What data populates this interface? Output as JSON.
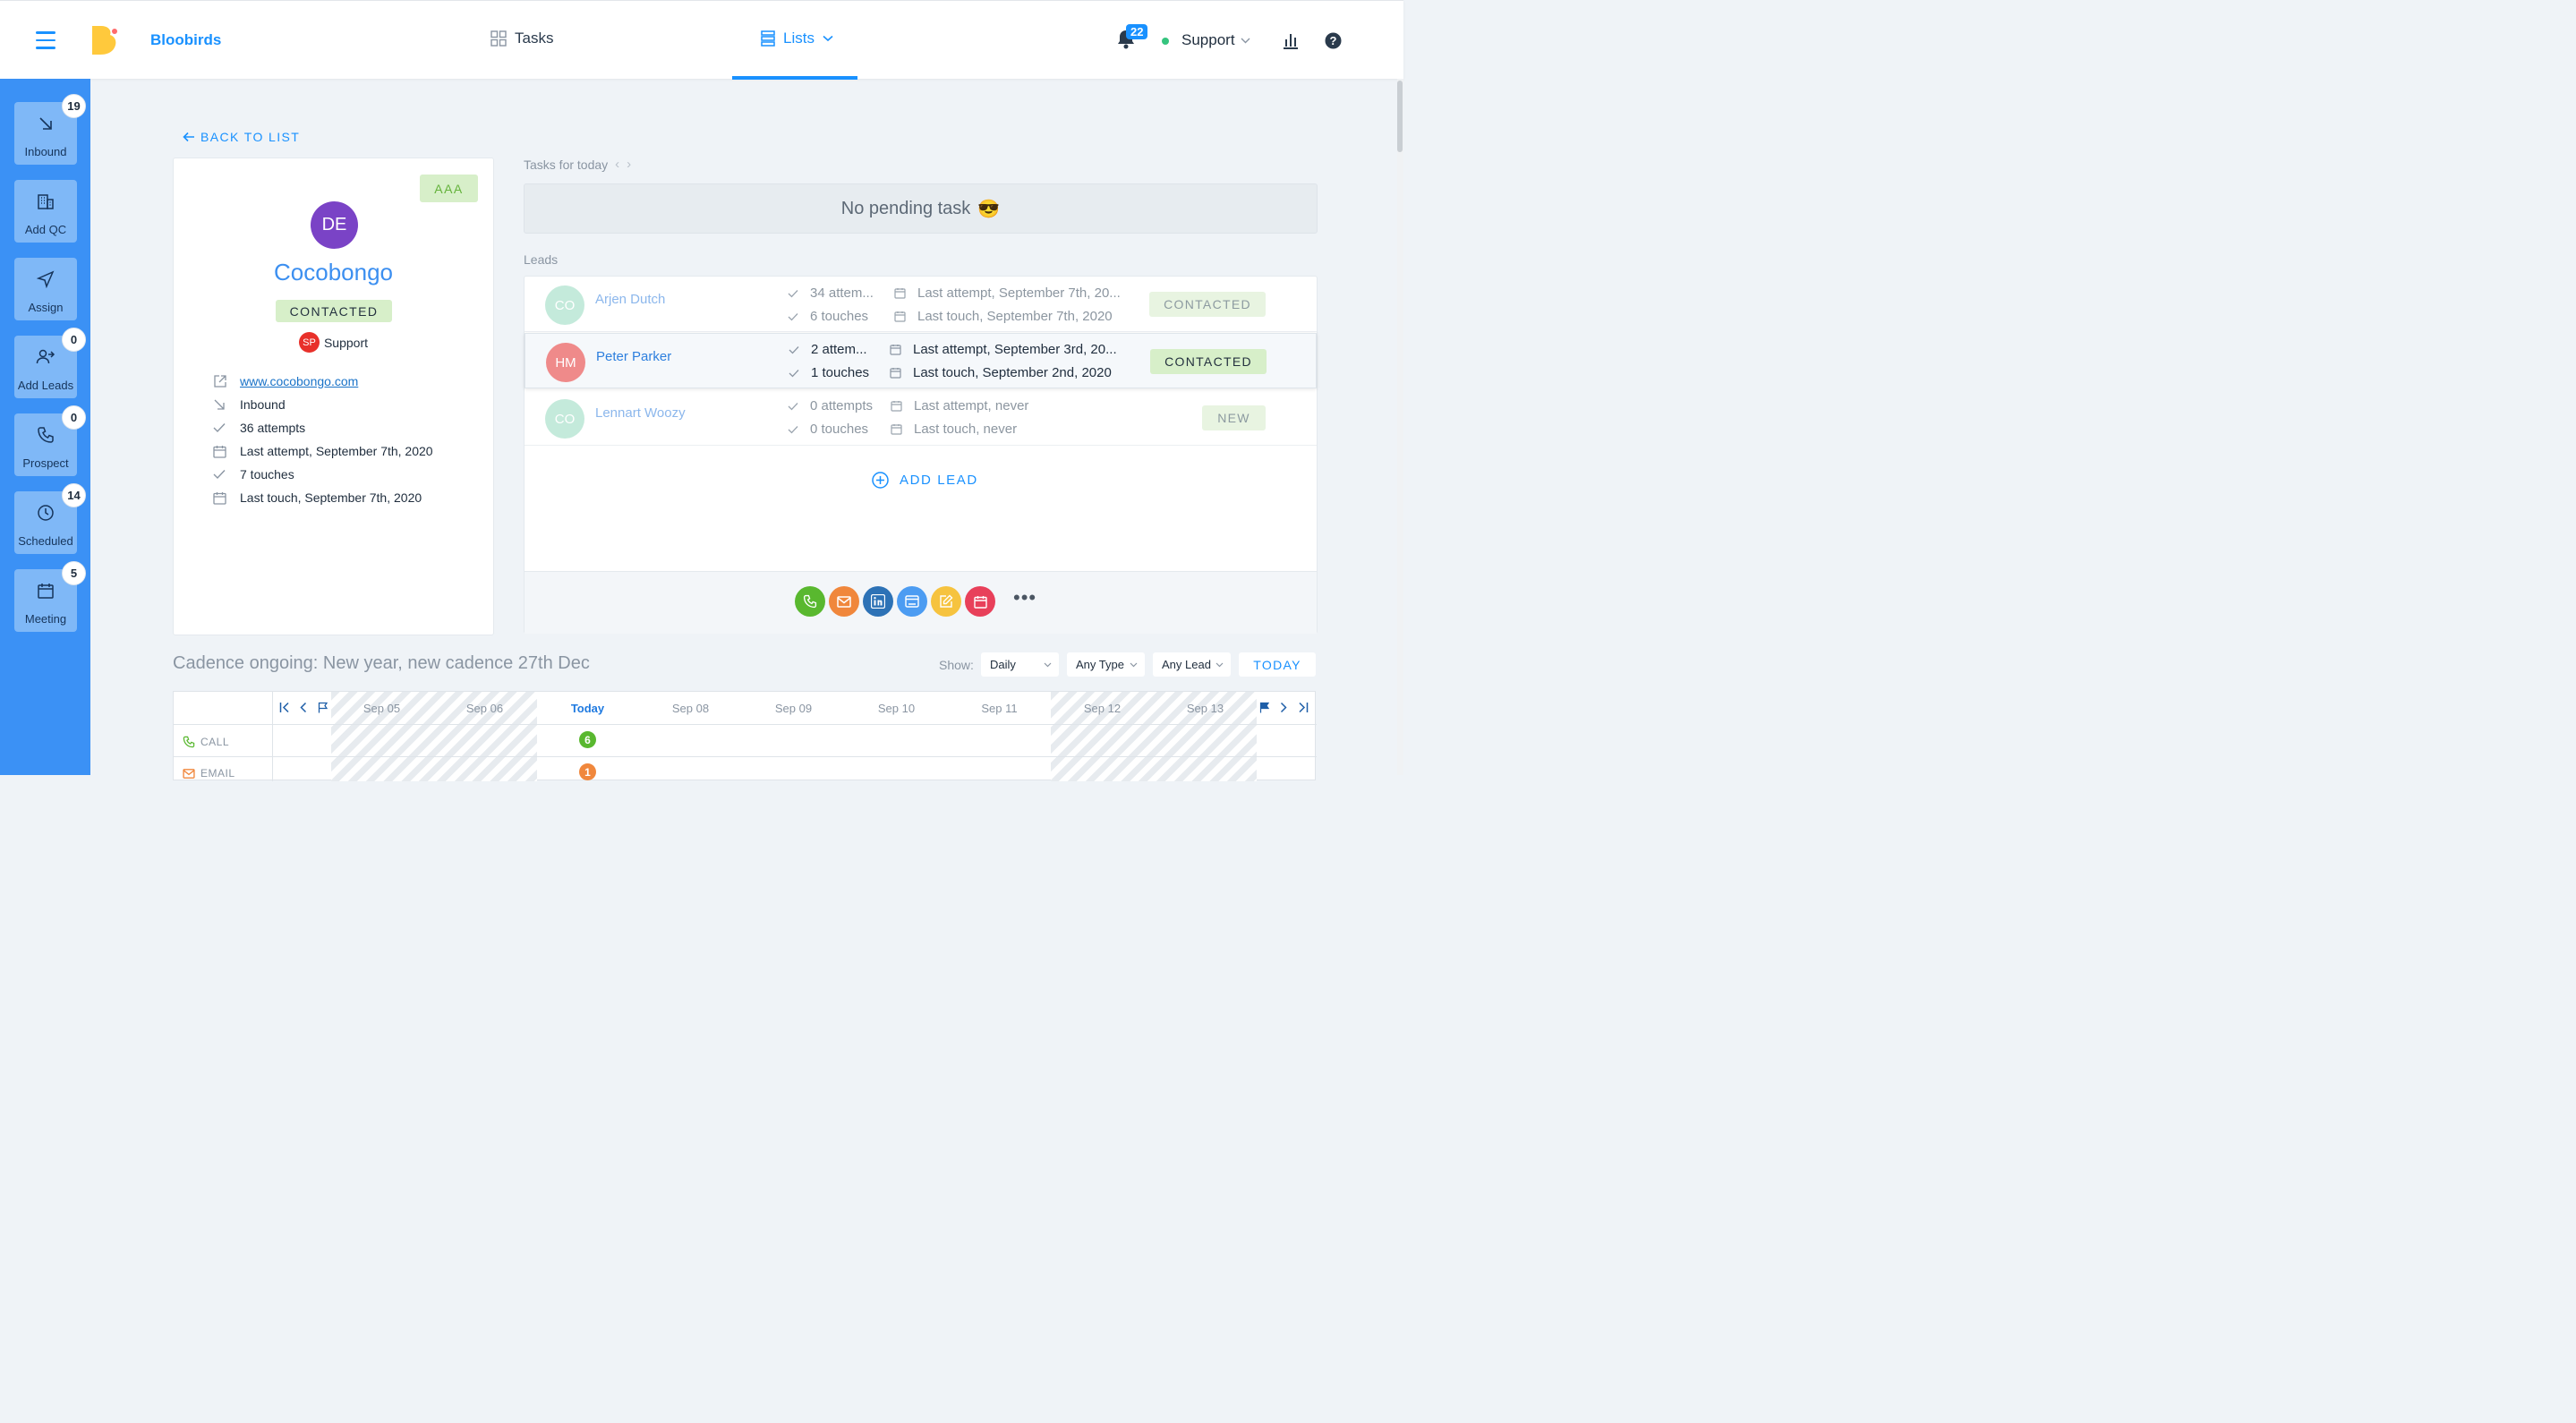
{
  "header": {
    "brand": "Bloobirds",
    "tasks_label": "Tasks",
    "lists_label": "Lists",
    "notifications_count": "22",
    "user_name": "Support",
    "accent_color": "#1991ff"
  },
  "sidebar": {
    "items": [
      {
        "label": "Inbound",
        "badge": "19",
        "icon": "arrow-down-right-icon"
      },
      {
        "label": "Add QC",
        "badge": "",
        "icon": "building-icon"
      },
      {
        "label": "Assign",
        "badge": "",
        "icon": "send-icon"
      },
      {
        "label": "Add Leads",
        "badge": "0",
        "icon": "user-plus-icon"
      },
      {
        "label": "Prospect",
        "badge": "0",
        "icon": "phone-icon"
      },
      {
        "label": "Scheduled",
        "badge": "14",
        "icon": "clock-icon"
      },
      {
        "label": "Meeting",
        "badge": "5",
        "icon": "calendar-icon"
      }
    ]
  },
  "back_link": "BACK TO LIST",
  "company": {
    "score": "AAA",
    "initials": "DE",
    "name": "Cocobongo",
    "status": "CONTACTED",
    "owner_initials": "SP",
    "owner_name": "Support",
    "website": "www.cocobongo.com",
    "source": "Inbound",
    "attempts": "36 attempts",
    "last_attempt": "Last attempt, September 7th, 2020",
    "touches": "7 touches",
    "last_touch": "Last touch, September 7th, 2020"
  },
  "tasks": {
    "label": "Tasks for today",
    "empty_text": "No pending task",
    "empty_emoji": "😎"
  },
  "leads": {
    "label": "Leads",
    "rows": [
      {
        "initials": "CO",
        "name": "Arjen Dutch",
        "attempts": "34 attem...",
        "touches": "6 touches",
        "last_attempt": "Last attempt, September 7th, 20...",
        "last_touch": "Last touch, September 7th, 2020",
        "status": "CONTACTED",
        "avatar_color": "#c4eadb"
      },
      {
        "initials": "HM",
        "name": "Peter Parker",
        "attempts": "2 attem...",
        "touches": "1 touches",
        "last_attempt": "Last attempt, September 3rd, 20...",
        "last_touch": "Last touch, September 2nd, 2020",
        "status": "CONTACTED",
        "avatar_color": "#ef8a8a"
      },
      {
        "initials": "CO",
        "name": "Lennart Woozy",
        "attempts": "0 attempts",
        "touches": "0 touches",
        "last_attempt": "Last attempt, never",
        "last_touch": "Last touch, never",
        "status": "NEW",
        "avatar_color": "#c4eadb"
      }
    ],
    "add_label": "ADD LEAD",
    "actions": [
      {
        "icon": "phone-icon",
        "color": "#59b82f"
      },
      {
        "icon": "mail-icon",
        "color": "#f0873c"
      },
      {
        "icon": "linkedin-icon",
        "color": "#2d72b6"
      },
      {
        "icon": "web-icon",
        "color": "#4c9cf2"
      },
      {
        "icon": "edit-icon",
        "color": "#f6c33f"
      },
      {
        "icon": "calendar-icon",
        "color": "#e8405a"
      }
    ]
  },
  "cadence": {
    "title": "Cadence ongoing: New year, new cadence 27th Dec",
    "show_label": "Show:",
    "filter_period": "Daily",
    "filter_type": "Any Type",
    "filter_lead": "Any Lead",
    "today_button": "TODAY",
    "days": [
      "Sep 05",
      "Sep 06",
      "Today",
      "Sep 08",
      "Sep 09",
      "Sep 10",
      "Sep 11",
      "Sep 12",
      "Sep 13"
    ],
    "rows": [
      {
        "label": "CALL",
        "count": "6",
        "color": "#59b82f"
      },
      {
        "label": "EMAIL",
        "count": "1",
        "color": "#f0873c"
      }
    ]
  }
}
